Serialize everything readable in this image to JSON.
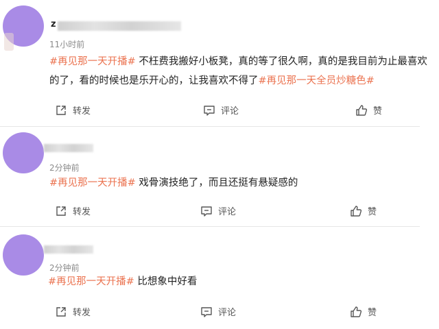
{
  "posts": [
    {
      "username_initial": "z",
      "time": "11小时前",
      "text_segments": [
        {
          "type": "tag",
          "text": "#再见那一天开播#"
        },
        {
          "type": "text",
          "text": " 不枉费我搬好小板凳，真的等了很久啊，真的是我目前为止最喜欢的了，看的时候也是乐开心的，让我喜欢不得了"
        },
        {
          "type": "tag",
          "text": "#再见那一天全员炒糖色#"
        }
      ],
      "actions": {
        "repost": "转发",
        "comment": "评论",
        "like": "赞"
      }
    },
    {
      "username_initial": "",
      "time": "2分钟前",
      "text_segments": [
        {
          "type": "tag",
          "text": "#再见那一天开播#"
        },
        {
          "type": "text",
          "text": " 戏骨演技绝了，而且还挺有悬疑感的"
        }
      ],
      "actions": {
        "repost": "转发",
        "comment": "评论",
        "like": "赞"
      }
    },
    {
      "username_initial": "",
      "time": "2分钟前",
      "text_segments": [
        {
          "type": "tag",
          "text": "#再见那一天开播#"
        },
        {
          "type": "text",
          "text": " 比想象中好看"
        }
      ],
      "actions": {
        "repost": "转发",
        "comment": "评论",
        "like": "赞"
      }
    }
  ],
  "colors": {
    "tag": "#eb7350",
    "avatar": "#a98be6",
    "divider": "#e6e6e6"
  },
  "icons": {
    "repost": "share-out-icon",
    "comment": "comment-icon",
    "like": "thumbs-up-icon"
  }
}
